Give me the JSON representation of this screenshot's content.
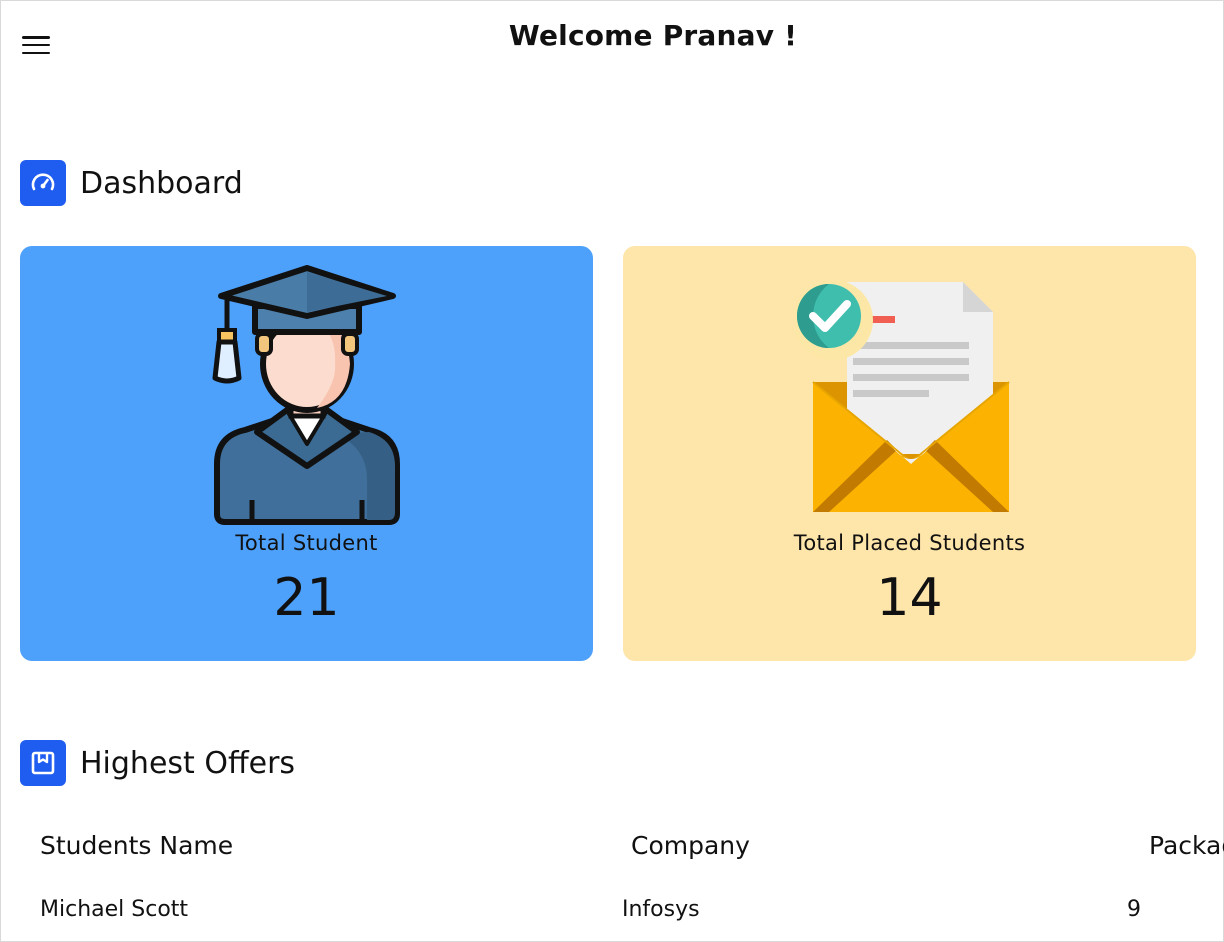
{
  "header": {
    "welcome": "Welcome Pranav !",
    "menu_icon": "hamburger-menu-icon"
  },
  "dashboard": {
    "title": "Dashboard",
    "icon": "speedometer-icon",
    "accent": "#1f5cf0"
  },
  "cards": [
    {
      "label": "Total Student",
      "value": "21",
      "icon": "graduate-student-icon",
      "background": "#4da1fb"
    },
    {
      "label": "Total Placed Students",
      "value": "14",
      "icon": "offer-letter-envelope-icon",
      "background": "#fee5aa"
    }
  ],
  "offers": {
    "title": "Highest Offers",
    "icon": "bookmark-box-icon",
    "columns": [
      "Students Name",
      "Company",
      "Package"
    ],
    "rows": [
      [
        "Michael Scott",
        "Infosys",
        "9"
      ]
    ]
  }
}
